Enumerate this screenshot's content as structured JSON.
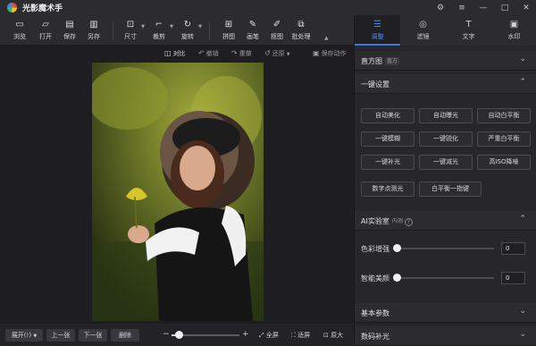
{
  "app": {
    "title": "光影魔术手"
  },
  "window_controls": [
    {
      "icon": "settings-hexagon-icon",
      "glyph": "⚙"
    },
    {
      "icon": "menu-icon",
      "glyph": "≡"
    },
    {
      "icon": "minimize-icon",
      "glyph": "—"
    },
    {
      "icon": "maximize-icon",
      "glyph": "□"
    },
    {
      "icon": "close-icon",
      "glyph": "✕"
    }
  ],
  "toolbar": {
    "browse": "浏览",
    "open": "打开",
    "save": "保存",
    "save_as": "另存",
    "size": "尺寸",
    "crop": "裁剪",
    "rotate": "旋转",
    "collage": "拼图",
    "brush": "画笔",
    "cutout": "抠图",
    "batch": "批处理"
  },
  "actions": {
    "compare": "对比",
    "undo": "撤销",
    "redo": "重做",
    "restore": "还原",
    "save_action": "保存动作"
  },
  "bottom": {
    "expand": "展开(!)",
    "prev": "上一张",
    "next": "下一张",
    "delete": "删除",
    "zoom_minus": "−",
    "zoom_plus": "+",
    "fullscreen": "全屏",
    "fit": "适屏",
    "original": "原大",
    "zoom_level": 0.1
  },
  "panel": {
    "tabs": [
      {
        "label": "调整",
        "icon": "adjust-sliders-icon",
        "glyph": "☰",
        "active": true
      },
      {
        "label": "滤镜",
        "icon": "filter-circles-icon",
        "glyph": "◎",
        "active": false
      },
      {
        "label": "文字",
        "icon": "text-icon",
        "glyph": "T",
        "active": false
      },
      {
        "label": "水印",
        "icon": "watermark-image-icon",
        "glyph": "▣",
        "active": false
      }
    ],
    "histogram": {
      "title": "直方图",
      "tag": "直方"
    },
    "oneclick": {
      "title": "一键设置",
      "buttons": [
        "自动美化",
        "自动曝光",
        "自动白平衡",
        "一键模糊",
        "一键锐化",
        "严重白平衡",
        "一键补光",
        "一键减光",
        "高ISO降噪",
        "数字点测光",
        "白平衡一指键"
      ]
    },
    "ai_lab": {
      "title": "AI实验室",
      "tag": "内测",
      "color_enhance": {
        "label": "色彩增强",
        "value": "0"
      },
      "smart_beauty": {
        "label": "智能美颜",
        "value": "0"
      }
    },
    "basic": {
      "title": "基本参数"
    },
    "digital_fill": {
      "title": "数码补光"
    }
  },
  "colors": {
    "accent": "#3a7be0",
    "bg": "#1e1e22",
    "panel": "#26262b"
  }
}
